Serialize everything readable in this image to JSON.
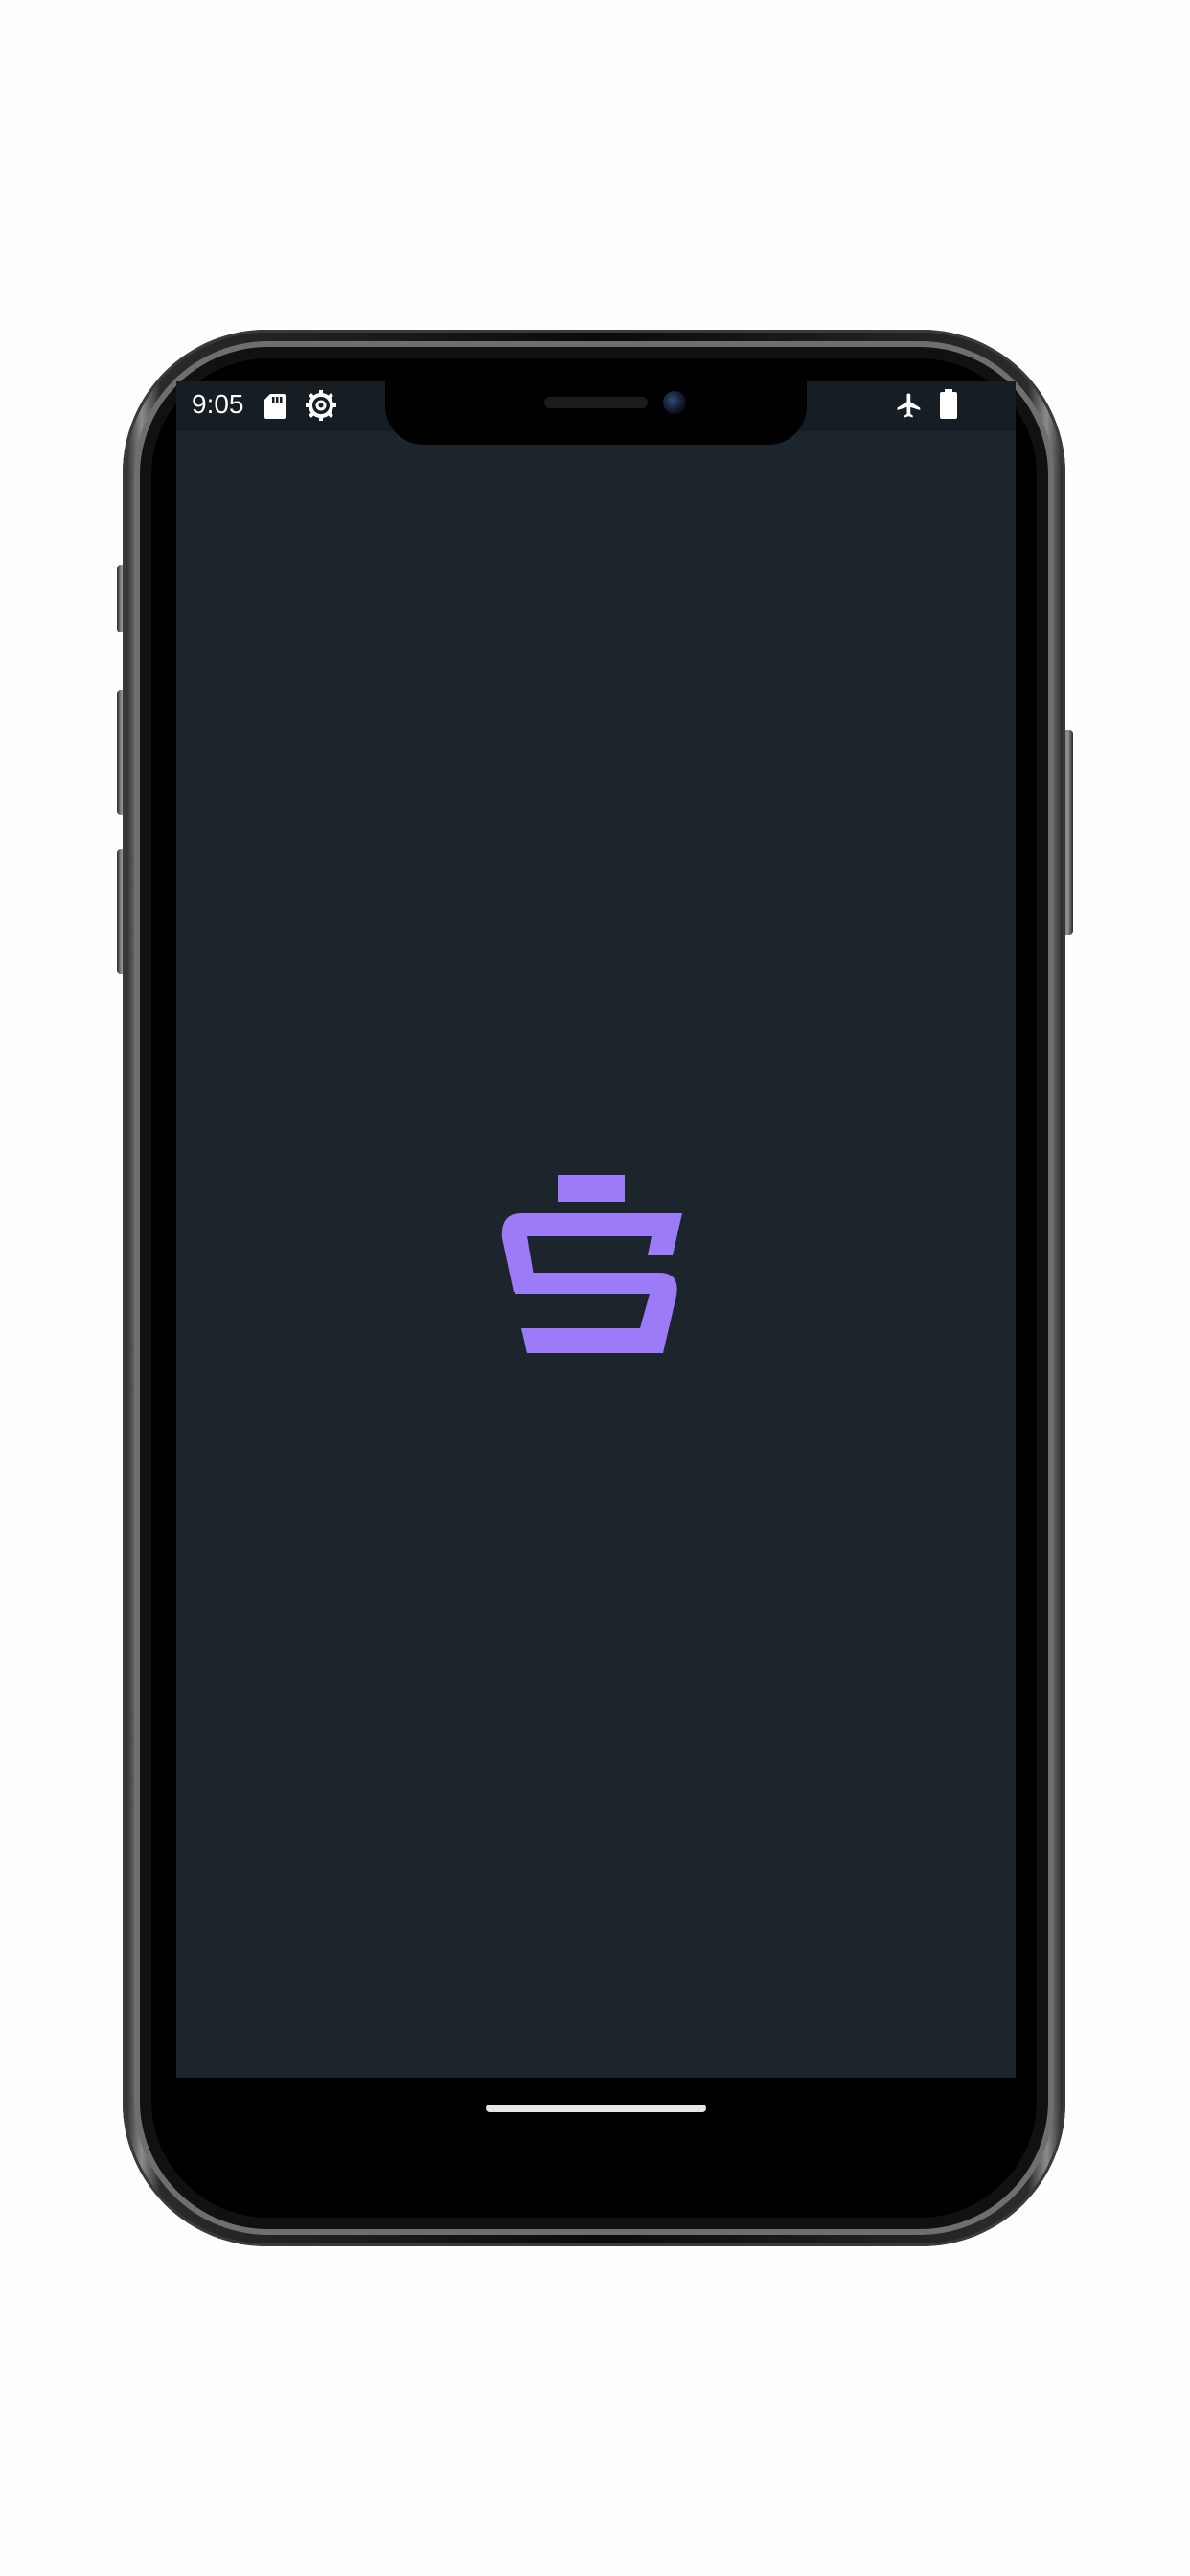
{
  "status_bar": {
    "time": "9:05",
    "icons": [
      "sd-card-icon",
      "settings-gear-icon",
      "airplane-mode-icon",
      "battery-icon"
    ]
  },
  "splash": {
    "logo_name": "app-logo-s-icon",
    "logo_color": "#9b7bf7",
    "background_color": "#1d252c"
  },
  "device": {
    "frame": "phone-frame",
    "home_indicator_color": "#e6e6e6"
  }
}
